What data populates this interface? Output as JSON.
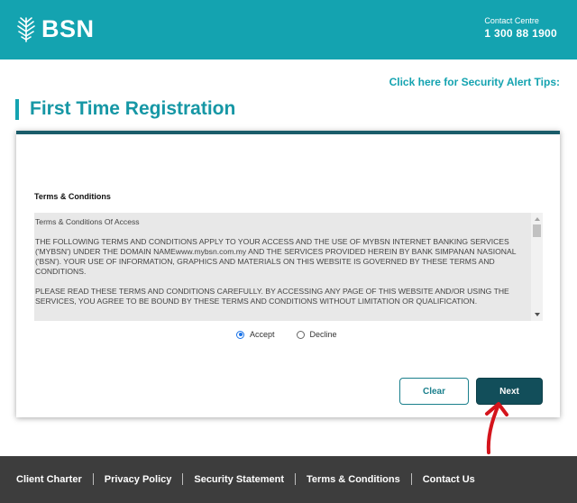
{
  "header": {
    "logo_text": "BSN",
    "contact_label": "Contact Centre",
    "contact_number": "1 300 88 1900",
    "colors": {
      "header_bg": "#14a3b0"
    }
  },
  "security_link": "Click here for Security Alert Tips:",
  "page_title": "First Time Registration",
  "form": {
    "terms_heading": "Terms & Conditions",
    "terms_paragraphs": [
      "Terms & Conditions Of Access",
      "THE FOLLOWING TERMS AND CONDITIONS APPLY TO YOUR ACCESS AND THE USE OF MYBSN INTERNET BANKING SERVICES ('MYBSN') UNDER THE DOMAIN NAMEwww.mybsn.com.my AND THE SERVICES PROVIDED HEREIN BY BANK SIMPANAN NASIONAL ('BSN'). YOUR USE OF INFORMATION, GRAPHICS AND MATERIALS ON THIS WEBSITE IS GOVERNED BY THESE TERMS AND CONDITIONS.",
      "PLEASE READ THESE TERMS AND CONDITIONS CAREFULLY. BY ACCESSING ANY PAGE OF THIS WEBSITE AND/OR USING THE SERVICES, YOU AGREE TO BE BOUND BY THESE TERMS AND CONDITIONS WITHOUT LIMITATION OR QUALIFICATION."
    ],
    "radio_options": [
      {
        "label": "Accept",
        "checked": true
      },
      {
        "label": "Decline",
        "checked": false
      }
    ],
    "clear_label": "Clear",
    "next_label": "Next"
  },
  "footer": {
    "links": [
      "Client Charter",
      "Privacy Policy",
      "Security Statement",
      "Terms & Conditions",
      "Contact Us"
    ]
  }
}
